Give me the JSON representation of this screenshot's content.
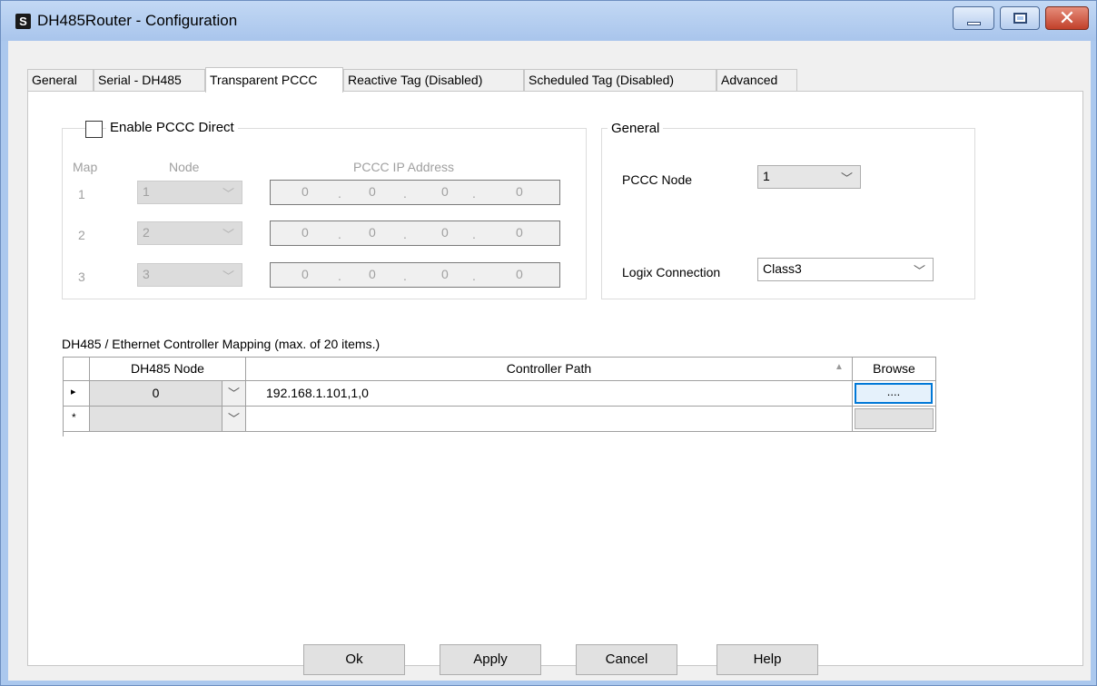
{
  "window": {
    "title": "DH485Router - Configuration",
    "app_icon_letter": "S"
  },
  "tabs": [
    {
      "label": "General"
    },
    {
      "label": "Serial - DH485"
    },
    {
      "label": "Transparent PCCC"
    },
    {
      "label": "Reactive Tag (Disabled)"
    },
    {
      "label": "Scheduled Tag (Disabled)"
    },
    {
      "label": "Advanced"
    }
  ],
  "active_tab": "Transparent PCCC",
  "pccc_direct": {
    "checkbox_label": "Enable PCCC Direct",
    "checked": false,
    "headers": {
      "map": "Map",
      "node": "Node",
      "ip": "PCCC IP Address"
    },
    "rows": [
      {
        "map": "1",
        "node": "1",
        "ip": [
          "0",
          "0",
          "0",
          "0"
        ]
      },
      {
        "map": "2",
        "node": "2",
        "ip": [
          "0",
          "0",
          "0",
          "0"
        ]
      },
      {
        "map": "3",
        "node": "3",
        "ip": [
          "0",
          "0",
          "0",
          "0"
        ]
      }
    ]
  },
  "general": {
    "title": "General",
    "pccc_node_label": "PCCC Node",
    "pccc_node_value": "1",
    "logix_connection_label": "Logix Connection",
    "logix_connection_value": "Class3"
  },
  "mapping": {
    "caption": "DH485 / Ethernet Controller Mapping (max. of 20 items.)",
    "columns": {
      "node": "DH485 Node",
      "path": "Controller Path",
      "browse": "Browse"
    },
    "rows": [
      {
        "indicator": "▸",
        "node": "0",
        "path": "192.168.1.101,1,0",
        "browse": "...."
      },
      {
        "indicator": "*",
        "node": "",
        "path": "",
        "browse": ""
      }
    ]
  },
  "buttons": {
    "ok": "Ok",
    "apply": "Apply",
    "cancel": "Cancel",
    "help": "Help"
  },
  "colors": {
    "titlebar": "#abc8ee",
    "close_button": "#c1402a",
    "selection": "#0078d7"
  }
}
